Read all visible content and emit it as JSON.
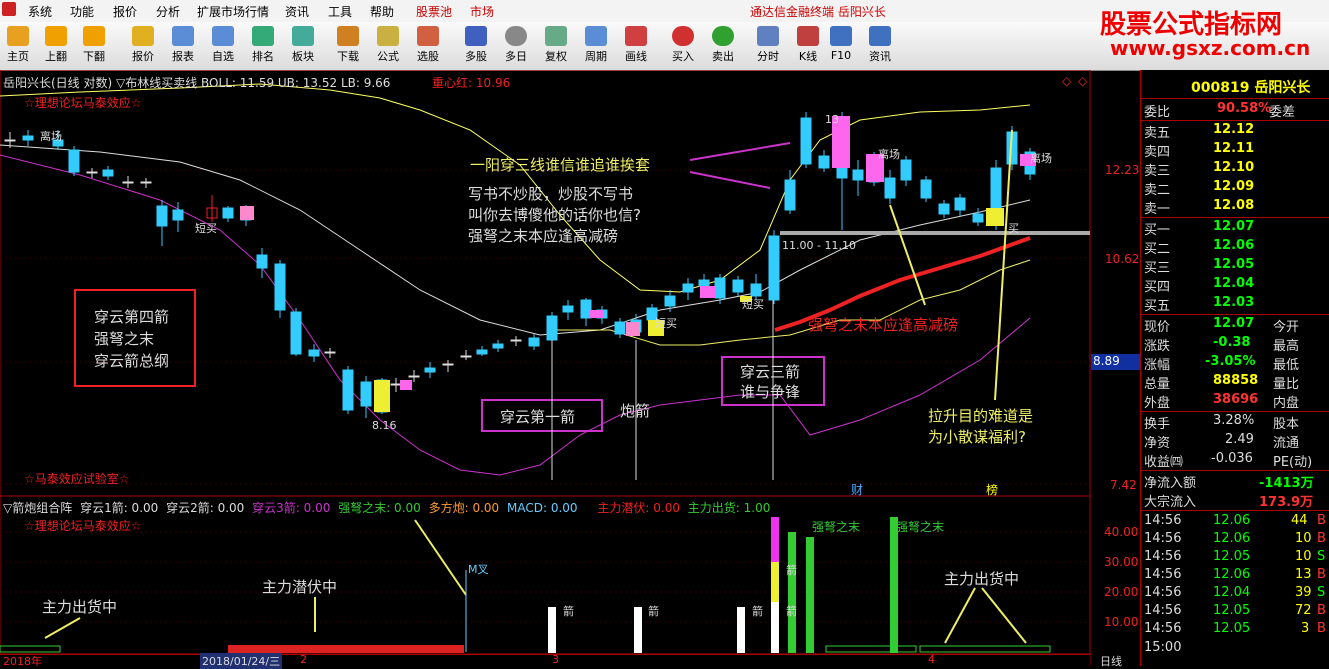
{
  "menu": {
    "items": [
      "系统",
      "功能",
      "报价",
      "分析",
      "扩展市场行情",
      "资讯",
      "工具",
      "帮助",
      "股票池",
      "市场"
    ],
    "title": "通达信金融终端 岳阳兴长"
  },
  "watermark": {
    "line1": "股票公式指标网",
    "line2": "www.gsxz.com.cn"
  },
  "toolbar": {
    "items": [
      "主页",
      "上翻",
      "下翻",
      "报价",
      "报表",
      "自选",
      "排名",
      "板块",
      "下载",
      "公式",
      "选股",
      "多股",
      "多日",
      "复权",
      "周期",
      "画线",
      "买入",
      "卖出",
      "分时",
      "K线",
      "F10",
      "资讯"
    ]
  },
  "main": {
    "header": "岳阳兴长(日线 对数) ▽布林线买卖线 BOLL: 11.59 UB: 13.52 LB: 9.66",
    "center_label": "重心红: 10.96",
    "forum_label": "☆理想论坛马泰效应☆",
    "lab_label": "☆马泰效应试验室☆",
    "diamond": "◇"
  },
  "price_axis": {
    "ticks": [
      "12.23",
      "10.62",
      "8.89",
      "7.42"
    ],
    "current": "8.89"
  },
  "annotations": {
    "a1": "一阳穿三线谁信谁追谁挨套",
    "a2": [
      "写书不炒股，炒股不写书",
      "叫你去博傻他的话你也信?",
      "强弩之末本应逢高减磅"
    ],
    "a3": "强弩之末本应逢高减磅",
    "a4": [
      "拉升目的难道是",
      "为小散谋福利?"
    ],
    "box1": [
      "穿云第四箭",
      "强弩之末",
      "穿云箭总纲"
    ],
    "box2": "穿云第一箭",
    "box3": [
      "穿云三箭",
      "谁与争锋"
    ],
    "pao": "炮箭",
    "range": "11.00 - 11.10",
    "low": "8.16",
    "high": "13",
    "cai": "财",
    "bang": "榜",
    "lichang": "离场",
    "duanmai": "短买",
    "mai": "买"
  },
  "sub": {
    "header_items": [
      "▽箭炮组合阵",
      "穿云1箭: 0.00",
      "穿云2箭: 0.00",
      "穿云3箭: 0.00",
      "强弩之末: 0.00",
      "多方炮: 0.00",
      "MACD: 0.00",
      "主力潜伏: 0.00",
      "主力出货: 1.00"
    ],
    "forum_label": "☆理想论坛马泰效应☆",
    "ticks": [
      "40.00",
      "30.00",
      "20.00",
      "10.00"
    ],
    "labels": {
      "chuhuo1": "主力出货中",
      "qianfu": "主力潜伏中",
      "chuhuo2": "主力出货中",
      "mcha": "M叉",
      "jian": "箭",
      "qiangnu": "强弩之末"
    }
  },
  "xaxis": {
    "labels": [
      "2018年",
      "2018/01/24/三",
      "2",
      "3",
      "4",
      "日线"
    ]
  },
  "chart_data": {
    "type": "candlestick",
    "title": "岳阳兴长(日线 对数)",
    "indicator": "BOLL",
    "boll": {
      "mid": 11.59,
      "upper": 13.52,
      "lower": 9.66
    },
    "center": 10.96,
    "yticks": [
      12.23,
      10.62,
      8.89,
      7.42
    ],
    "low": 8.16,
    "range": [
      11.0,
      11.1
    ]
  },
  "right": {
    "code_name": "000819 岳阳兴长",
    "wei": {
      "label": "委比",
      "value": "90.58%",
      "label2": "委差"
    },
    "sells": [
      {
        "l": "卖五",
        "p": "12.12"
      },
      {
        "l": "卖四",
        "p": "12.11"
      },
      {
        "l": "卖三",
        "p": "12.10"
      },
      {
        "l": "卖二",
        "p": "12.09"
      },
      {
        "l": "卖一",
        "p": "12.08"
      }
    ],
    "buys": [
      {
        "l": "买一",
        "p": "12.07"
      },
      {
        "l": "买二",
        "p": "12.06"
      },
      {
        "l": "买三",
        "p": "12.05"
      },
      {
        "l": "买四",
        "p": "12.04"
      },
      {
        "l": "买五",
        "p": "12.03"
      }
    ],
    "stats": [
      {
        "l": "现价",
        "v": "12.07",
        "l2": "今开",
        "c": "#0f0"
      },
      {
        "l": "涨跌",
        "v": "-0.38",
        "l2": "最高",
        "c": "#0f0"
      },
      {
        "l": "涨幅",
        "v": "-3.05%",
        "l2": "最低",
        "c": "#0f0"
      },
      {
        "l": "总量",
        "v": "88858",
        "l2": "量比",
        "c": "#ff0"
      },
      {
        "l": "外盘",
        "v": "38696",
        "l2": "内盘",
        "c": "#f33"
      }
    ],
    "stats2": [
      {
        "l": "换手",
        "v": "3.28%",
        "l2": "股本",
        "c": "#ddd"
      },
      {
        "l": "净资",
        "v": "2.49",
        "l2": "流通",
        "c": "#ddd"
      },
      {
        "l": "收益㈣",
        "v": "-0.036",
        "l2": "PE(动)",
        "c": "#ddd"
      }
    ],
    "flow": [
      {
        "l": "净流入额",
        "v": "-1413万"
      },
      {
        "l": "大宗流入",
        "v": "173.9万"
      }
    ],
    "ticks": [
      {
        "t": "14:56",
        "p": "12.06",
        "v": "44"
      },
      {
        "t": "14:56",
        "p": "12.06",
        "v": "10"
      },
      {
        "t": "14:56",
        "p": "12.05",
        "v": "10"
      },
      {
        "t": "14:56",
        "p": "12.06",
        "v": "13"
      },
      {
        "t": "14:56",
        "p": "12.04",
        "v": "39"
      },
      {
        "t": "14:56",
        "p": "12.05",
        "v": "72"
      },
      {
        "t": "14:56",
        "p": "12.05",
        "v": "3"
      }
    ],
    "last_time": "15:00"
  }
}
